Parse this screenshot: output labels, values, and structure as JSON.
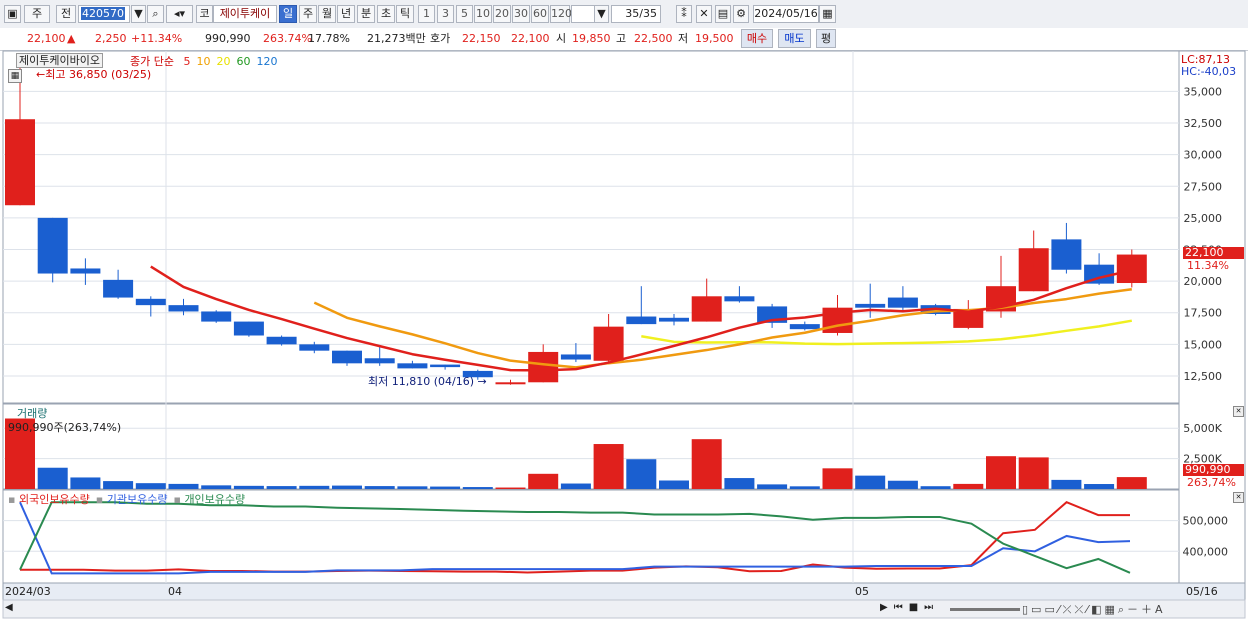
{
  "toolbar": {
    "market": "주",
    "prev_label": "전",
    "code": "420570",
    "name_prefix": "코",
    "stock_name": "제이투케이",
    "periods": [
      "일",
      "주",
      "월",
      "년",
      "분",
      "초",
      "틱"
    ],
    "minutes": [
      "1",
      "3",
      "5",
      "10",
      "20",
      "30",
      "60",
      "120"
    ],
    "count": "35/35",
    "date": "2024/05/16"
  },
  "info": {
    "price": "22,100",
    "arrow": "▲",
    "change": "2,250",
    "rate": "+11.34%",
    "volume": "990,990",
    "vol_ratio": "263.74%",
    "turnover": "17.78%",
    "amount": "21,273백만",
    "quote_label": "호가",
    "ask": "22,150",
    "bid": "22,100",
    "open_label": "시",
    "open": "19,850",
    "high_label": "고",
    "high": "22,500",
    "low_label": "저",
    "low": "19,500",
    "buy": "매수",
    "sell": "매도",
    "avg": "평"
  },
  "price_panel": {
    "name_box": "제이투케이바이오",
    "ma_label": "종가 단순",
    "ma_periods": [
      "5",
      "10",
      "20",
      "60",
      "120"
    ],
    "ma_colors": [
      "#e0201c",
      "#f0a000",
      "#e8e000",
      "#229922",
      "#1a76d0"
    ],
    "high_annot": "←최고 36,850 (03/25)",
    "low_annot": "최저 11,810 (04/16) →",
    "lc": "LC:87,13",
    "hc": "HC:-40,03",
    "cur_price": "22,100",
    "cur_rate": "11.34%",
    "y_ticks": [
      "35,000",
      "32,500",
      "30,000",
      "27,500",
      "25,000",
      "22,500",
      "20,000",
      "17,500",
      "15,000",
      "12,500"
    ]
  },
  "volume_panel": {
    "title": "거래량",
    "annot": "990,990주(263,74%)",
    "y_ticks": [
      "5,000K",
      "2,500K"
    ],
    "cur_value": "990,990",
    "cur_rate": "263,74%"
  },
  "holding_panel": {
    "legend": [
      "외국인보유수량",
      "기관보유수량",
      "개인보유수량"
    ],
    "colors": [
      "#e0201c",
      "#3060e0",
      "#2a8a50"
    ],
    "y_ticks": [
      "500,000",
      "400,000"
    ]
  },
  "x_axis": {
    "labels": [
      "2024/03",
      "04",
      "05"
    ],
    "end_label": "05/16"
  },
  "chart_data": {
    "type": "candlestick",
    "candles": [
      {
        "o": 26000,
        "h": 36850,
        "l": 26000,
        "c": 32800
      },
      {
        "o": 25000,
        "h": 25000,
        "l": 19900,
        "c": 20600
      },
      {
        "o": 21000,
        "h": 21800,
        "l": 19700,
        "c": 20600
      },
      {
        "o": 20100,
        "h": 20900,
        "l": 18600,
        "c": 18700
      },
      {
        "o": 18600,
        "h": 18800,
        "l": 17200,
        "c": 18100
      },
      {
        "o": 18100,
        "h": 18600,
        "l": 17300,
        "c": 17600
      },
      {
        "o": 17600,
        "h": 17700,
        "l": 16700,
        "c": 16800
      },
      {
        "o": 16800,
        "h": 16800,
        "l": 15600,
        "c": 15700
      },
      {
        "o": 15600,
        "h": 15700,
        "l": 14900,
        "c": 15000
      },
      {
        "o": 15000,
        "h": 15200,
        "l": 14300,
        "c": 14500
      },
      {
        "o": 14500,
        "h": 14500,
        "l": 13300,
        "c": 13500
      },
      {
        "o": 13900,
        "h": 14800,
        "l": 13300,
        "c": 13500
      },
      {
        "o": 13500,
        "h": 13700,
        "l": 13100,
        "c": 13100
      },
      {
        "o": 13400,
        "h": 13400,
        "l": 13000,
        "c": 13200
      },
      {
        "o": 12900,
        "h": 13000,
        "l": 12200,
        "c": 12400
      },
      {
        "o": 12000,
        "h": 12200,
        "l": 11810,
        "c": 12000
      },
      {
        "o": 12000,
        "h": 15000,
        "l": 12000,
        "c": 14400
      },
      {
        "o": 14200,
        "h": 15100,
        "l": 13600,
        "c": 13800
      },
      {
        "o": 13700,
        "h": 17400,
        "l": 13600,
        "c": 16400
      },
      {
        "o": 17200,
        "h": 19600,
        "l": 16600,
        "c": 16600
      },
      {
        "o": 17100,
        "h": 17400,
        "l": 16500,
        "c": 16800
      },
      {
        "o": 16800,
        "h": 20200,
        "l": 16800,
        "c": 18800
      },
      {
        "o": 18800,
        "h": 19600,
        "l": 18300,
        "c": 18400
      },
      {
        "o": 18000,
        "h": 18200,
        "l": 16300,
        "c": 16700
      },
      {
        "o": 16600,
        "h": 16800,
        "l": 16100,
        "c": 16200
      },
      {
        "o": 15900,
        "h": 18900,
        "l": 15700,
        "c": 17900
      },
      {
        "o": 18200,
        "h": 19800,
        "l": 17100,
        "c": 17900
      },
      {
        "o": 18700,
        "h": 19600,
        "l": 17700,
        "c": 17900
      },
      {
        "o": 18100,
        "h": 18200,
        "l": 17300,
        "c": 17400
      },
      {
        "o": 16300,
        "h": 18500,
        "l": 16200,
        "c": 17800
      },
      {
        "o": 17600,
        "h": 22000,
        "l": 17100,
        "c": 19600
      },
      {
        "o": 19200,
        "h": 24000,
        "l": 19200,
        "c": 22600
      },
      {
        "o": 23300,
        "h": 24600,
        "l": 20600,
        "c": 20900
      },
      {
        "o": 21300,
        "h": 22200,
        "l": 19700,
        "c": 19800
      },
      {
        "o": 19850,
        "h": 22500,
        "l": 19500,
        "c": 22100
      }
    ],
    "ma5": [
      null,
      null,
      null,
      null,
      21150,
      19540,
      18580,
      17720,
      17000,
      16240,
      15500,
      14860,
      14220,
      13780,
      13380,
      12960,
      12940,
      13040,
      13560,
      14200,
      14880,
      15560,
      16320,
      16920,
      17120,
      17500,
      17720,
      17620,
      17820,
      17580,
      17960,
      18520,
      19440,
      20260,
      20860
    ],
    "ma10": [
      null,
      null,
      null,
      null,
      null,
      null,
      null,
      null,
      null,
      18300,
      17100,
      16420,
      15790,
      15080,
      14310,
      13710,
      13430,
      13180,
      13510,
      13780,
      14170,
      14550,
      15000,
      15540,
      15920,
      16480,
      16870,
      17300,
      17620,
      17700,
      17890,
      18270,
      18580,
      19010,
      19360
    ],
    "ma20": [
      null,
      null,
      null,
      null,
      null,
      null,
      null,
      null,
      null,
      null,
      null,
      null,
      null,
      null,
      null,
      null,
      null,
      null,
      null,
      15640,
      15200,
      15150,
      15170,
      15160,
      15060,
      15020,
      15060,
      15100,
      15150,
      15240,
      15400,
      15700,
      16070,
      16420,
      16870
    ],
    "volume_k": [
      5800,
      1750,
      950,
      650,
      480,
      420,
      300,
      260,
      240,
      260,
      280,
      240,
      220,
      200,
      160,
      120,
      1250,
      450,
      3700,
      2450,
      700,
      4100,
      900,
      380,
      220,
      1700,
      1100,
      680,
      230,
      420,
      2700,
      2600,
      750,
      410,
      980
    ],
    "holdings": {
      "foreign": [
        340000,
        340000,
        340000,
        337000,
        337000,
        341000,
        336000,
        336000,
        334000,
        334000,
        336000,
        337000,
        336000,
        335000,
        334000,
        334000,
        331000,
        334000,
        337000,
        337000,
        347000,
        351000,
        348000,
        335000,
        336000,
        357000,
        347000,
        343000,
        344000,
        344000,
        355000,
        459000,
        470000,
        560000,
        518000,
        518000
      ],
      "institution": [
        560000,
        328000,
        328000,
        328000,
        328000,
        328000,
        333000,
        333000,
        333000,
        333000,
        338000,
        338000,
        338000,
        342000,
        342000,
        342000,
        342000,
        342000,
        342000,
        342000,
        350000,
        350000,
        350000,
        350000,
        350000,
        350000,
        350000,
        352000,
        352000,
        352000,
        352000,
        410000,
        400000,
        450000,
        430000,
        433000
      ],
      "individual": [
        340000,
        560000,
        560000,
        560000,
        555000,
        555000,
        550000,
        550000,
        546000,
        546000,
        542000,
        540000,
        538000,
        535000,
        532000,
        530000,
        528000,
        528000,
        526000,
        526000,
        520000,
        520000,
        520000,
        522000,
        514000,
        503000,
        509000,
        509000,
        512000,
        512000,
        490000,
        425000,
        385000,
        345000,
        375000,
        330000
      ]
    },
    "price_range": [
      10600,
      37800
    ],
    "volume_range": [
      0,
      6500
    ],
    "holding_range": [
      300000,
      590000
    ]
  }
}
